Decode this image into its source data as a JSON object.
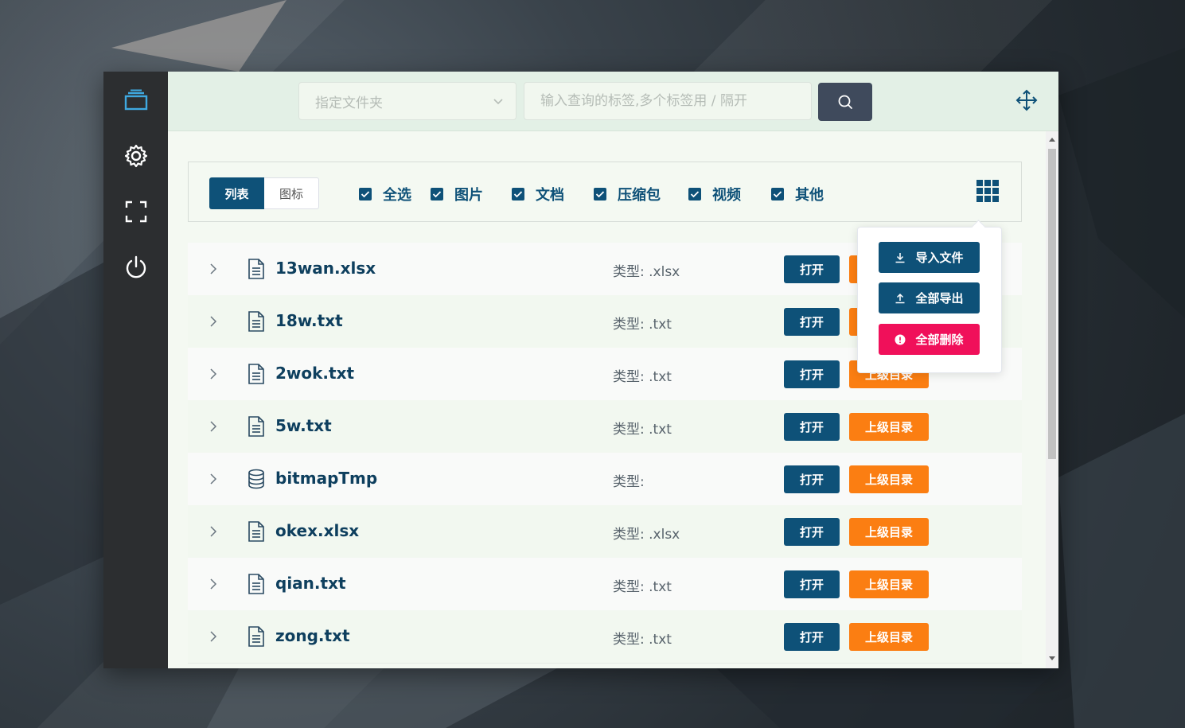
{
  "toolbar": {
    "folder_placeholder": "指定文件夹",
    "search_placeholder": "输入查询的标签,多个标签用 / 隔开"
  },
  "view_toggle": {
    "list": "列表",
    "icon": "图标",
    "active": "list"
  },
  "filters": [
    {
      "label": "全选",
      "checked": true
    },
    {
      "label": "图片",
      "checked": true
    },
    {
      "label": "文档",
      "checked": true
    },
    {
      "label": "压缩包",
      "checked": true
    },
    {
      "label": "视频",
      "checked": true
    },
    {
      "label": "其他",
      "checked": true
    }
  ],
  "actions_menu": {
    "import_label": "导入文件",
    "export_label": "全部导出",
    "delete_label": "全部删除"
  },
  "files": [
    {
      "name": "13wan.xlsx",
      "type_label": "类型:",
      "type": ".xlsx",
      "icon": "document-icon"
    },
    {
      "name": "18w.txt",
      "type_label": "类型:",
      "type": ".txt",
      "icon": "document-icon"
    },
    {
      "name": "2wok.txt",
      "type_label": "类型:",
      "type": ".txt",
      "icon": "document-icon"
    },
    {
      "name": "5w.txt",
      "type_label": "类型:",
      "type": ".txt",
      "icon": "document-icon"
    },
    {
      "name": "bitmapTmp",
      "type_label": "类型:",
      "type": "",
      "icon": "database-icon"
    },
    {
      "name": "okex.xlsx",
      "type_label": "类型:",
      "type": ".xlsx",
      "icon": "document-icon"
    },
    {
      "name": "qian.txt",
      "type_label": "类型:",
      "type": ".txt",
      "icon": "document-icon"
    },
    {
      "name": "zong.txt",
      "type_label": "类型:",
      "type": ".txt",
      "icon": "document-icon"
    }
  ],
  "row_buttons": {
    "open": "打开",
    "parent": "上级目录"
  },
  "colors": {
    "primary": "#0e5178",
    "orange": "#fb7e12",
    "danger": "#f0105a",
    "sidebar": "#2c2e30",
    "accent_icon": "#3fa9e0"
  }
}
